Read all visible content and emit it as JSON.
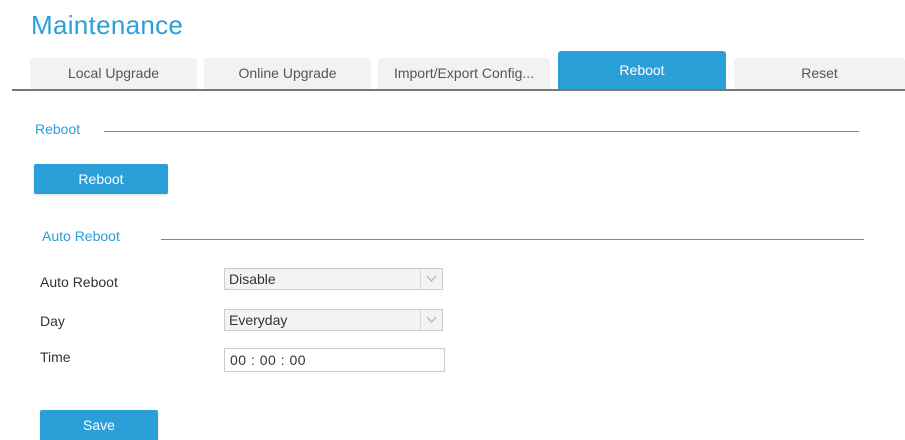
{
  "page": {
    "title": "Maintenance"
  },
  "tabs": [
    {
      "label": "Local Upgrade",
      "active": false
    },
    {
      "label": "Online Upgrade",
      "active": false
    },
    {
      "label": "Import/Export Config...",
      "active": false
    },
    {
      "label": "Reboot",
      "active": true
    },
    {
      "label": "Reset",
      "active": false
    }
  ],
  "reboot_section": {
    "title": "Reboot",
    "button_label": "Reboot"
  },
  "auto_reboot_section": {
    "title": "Auto Reboot",
    "fields": {
      "auto_reboot": {
        "label": "Auto Reboot",
        "value": "Disable"
      },
      "day": {
        "label": "Day",
        "value": "Everyday"
      },
      "time": {
        "label": "Time",
        "value": "00 : 00 : 00"
      }
    }
  },
  "footer": {
    "save_label": "Save"
  },
  "colors": {
    "accent": "#2a9fd8",
    "tab_inactive": "#f2f2f2",
    "divider": "#777777"
  },
  "icons": {
    "dropdown": "chevron-down-icon"
  }
}
